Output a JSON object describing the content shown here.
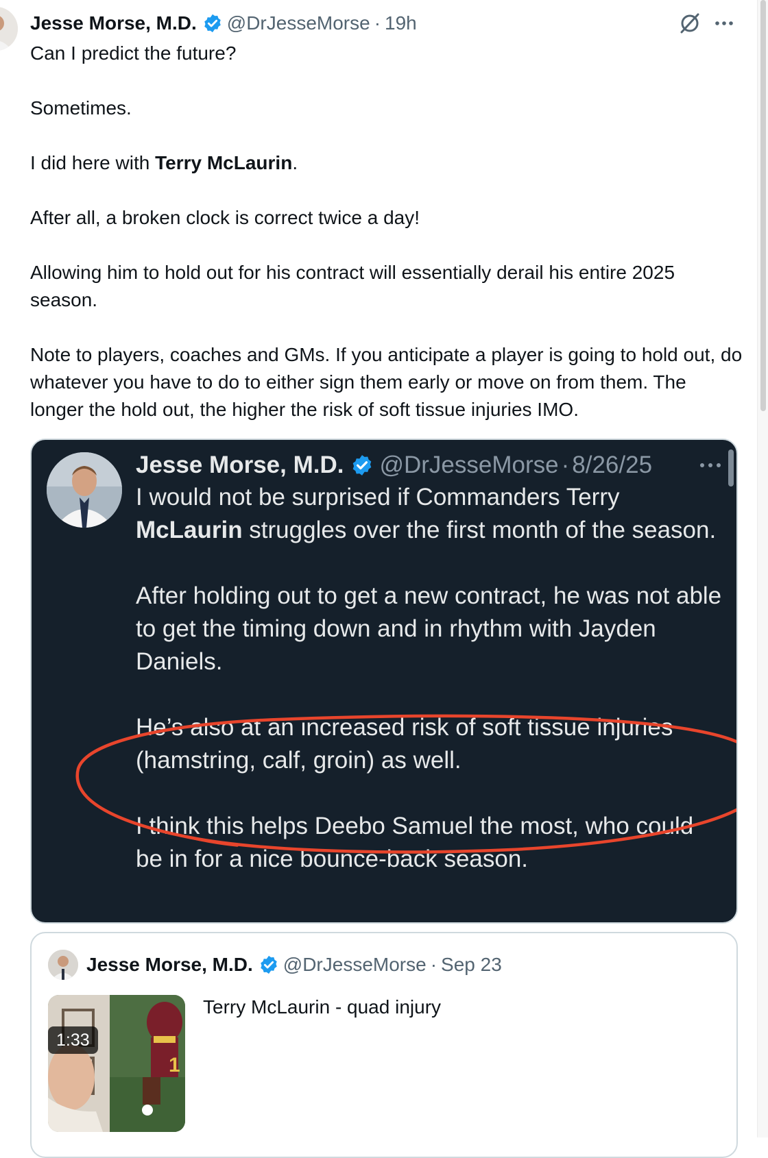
{
  "tweet": {
    "author_name": "Jesse Morse, M.D.",
    "handle": "@DrJesseMorse",
    "separator": "·",
    "time": "19h",
    "more_icon": "more-dots-icon",
    "grok_icon": "grok-slash-icon",
    "paragraphs": {
      "p1": "Can I predict the future?",
      "p2": "Sometimes.",
      "p3_before": "I did here with ",
      "p3_bold": "Terry McLaurin",
      "p3_after": ".",
      "p4": "After all, a broken clock is correct twice a day!",
      "p5": "Allowing him to hold out for his contract will essentially derail his entire 2025 season.",
      "p6": "Note to players, coaches and GMs. If you anticipate a player is going to hold out, do whatever you have to do to either sign them early or move on from them. The longer the hold out, the higher the risk of soft tissue injuries IMO."
    }
  },
  "quoted_screenshot": {
    "theme": "dark",
    "background": "#15202b",
    "author_name": "Jesse Morse, M.D.",
    "handle": "@DrJesseMorse",
    "separator": "·",
    "date": "8/26/25",
    "more_icon": "more-dots-icon",
    "paragraphs": {
      "p1_before": "I would not be surprised if Commanders  Terry ",
      "p1_bold": "McLaurin",
      "p1_after": " struggles over the first month of the season.",
      "p2": "After holding out to get a new contract, he was not able to get the timing down and in rhythm with Jayden Daniels.",
      "p3": "He’s also at an increased risk of soft tissue injuries (hamstring, calf, groin) as well.",
      "p4": "I think this helps Deebo Samuel the most, who could be in for a nice bounce-back season."
    },
    "annotation_color": "#e8452c"
  },
  "nested_quote": {
    "author_name": "Jesse Morse, M.D.",
    "handle": "@DrJesseMorse",
    "separator": "·",
    "date": "Sep 23",
    "text": "Terry McLaurin - quad injury",
    "video_duration": "1:33"
  },
  "colors": {
    "verified_blue": "#1d9bf0",
    "secondary_text": "#536471",
    "dark_text": "#e7e9ea",
    "dark_secondary": "#8b98a5"
  }
}
